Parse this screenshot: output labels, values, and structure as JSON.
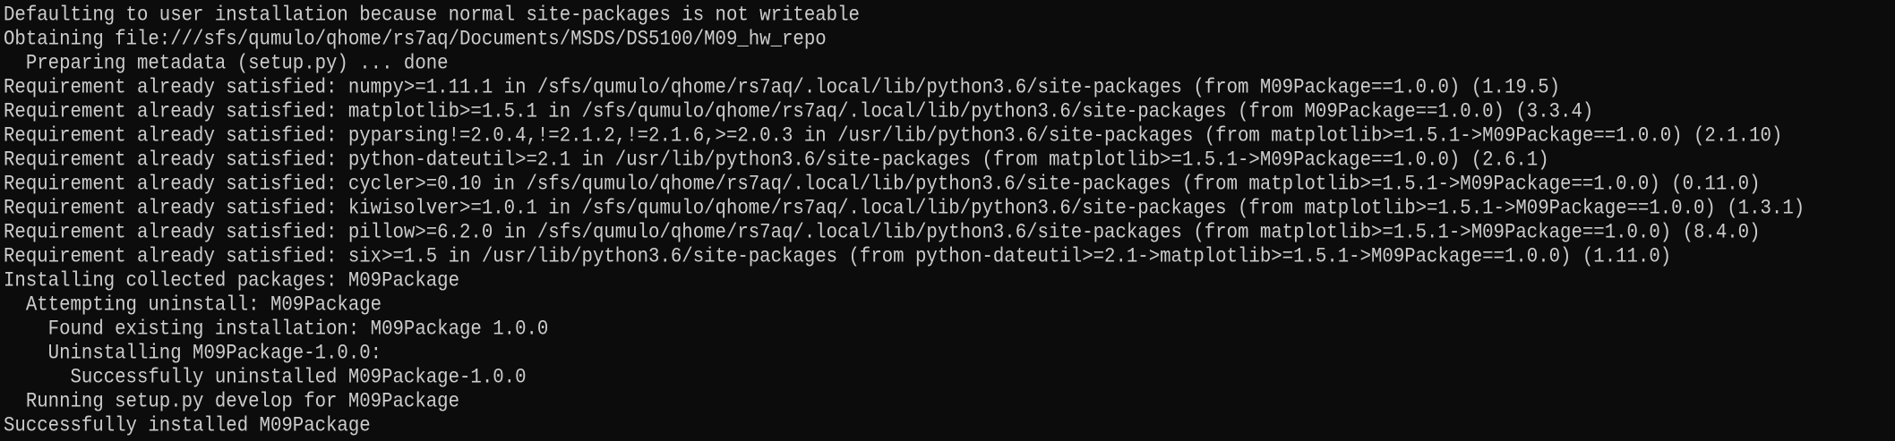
{
  "terminal": {
    "background": "#0c0c0c",
    "foreground": "#cccccc",
    "lines": [
      "Defaulting to user installation because normal site-packages is not writeable",
      "Obtaining file:///sfs/qumulo/qhome/rs7aq/Documents/MSDS/DS5100/M09_hw_repo",
      "  Preparing metadata (setup.py) ... done",
      "Requirement already satisfied: numpy>=1.11.1 in /sfs/qumulo/qhome/rs7aq/.local/lib/python3.6/site-packages (from M09Package==1.0.0) (1.19.5)",
      "Requirement already satisfied: matplotlib>=1.5.1 in /sfs/qumulo/qhome/rs7aq/.local/lib/python3.6/site-packages (from M09Package==1.0.0) (3.3.4)",
      "Requirement already satisfied: pyparsing!=2.0.4,!=2.1.2,!=2.1.6,>=2.0.3 in /usr/lib/python3.6/site-packages (from matplotlib>=1.5.1->M09Package==1.0.0) (2.1.10)",
      "Requirement already satisfied: python-dateutil>=2.1 in /usr/lib/python3.6/site-packages (from matplotlib>=1.5.1->M09Package==1.0.0) (2.6.1)",
      "Requirement already satisfied: cycler>=0.10 in /sfs/qumulo/qhome/rs7aq/.local/lib/python3.6/site-packages (from matplotlib>=1.5.1->M09Package==1.0.0) (0.11.0)",
      "Requirement already satisfied: kiwisolver>=1.0.1 in /sfs/qumulo/qhome/rs7aq/.local/lib/python3.6/site-packages (from matplotlib>=1.5.1->M09Package==1.0.0) (1.3.1)",
      "Requirement already satisfied: pillow>=6.2.0 in /sfs/qumulo/qhome/rs7aq/.local/lib/python3.6/site-packages (from matplotlib>=1.5.1->M09Package==1.0.0) (8.4.0)",
      "Requirement already satisfied: six>=1.5 in /usr/lib/python3.6/site-packages (from python-dateutil>=2.1->matplotlib>=1.5.1->M09Package==1.0.0) (1.11.0)",
      "Installing collected packages: M09Package",
      "  Attempting uninstall: M09Package",
      "    Found existing installation: M09Package 1.0.0",
      "    Uninstalling M09Package-1.0.0:",
      "      Successfully uninstalled M09Package-1.0.0",
      "  Running setup.py develop for M09Package",
      "Successfully installed M09Package"
    ]
  }
}
